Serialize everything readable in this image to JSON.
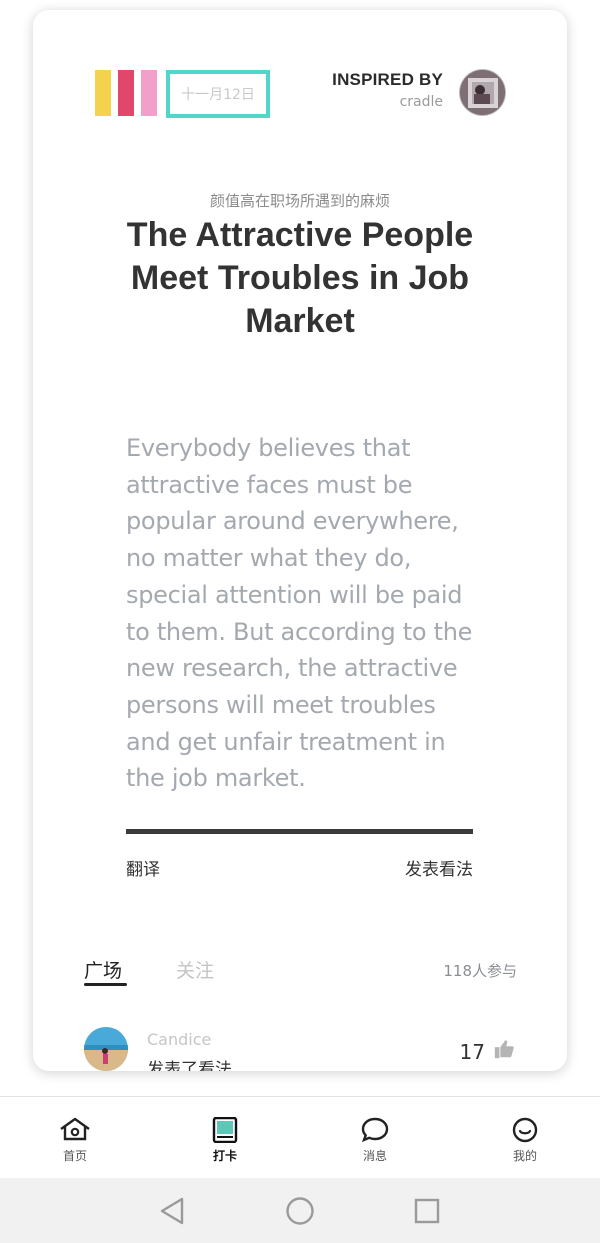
{
  "card": {
    "date": "十一月12日",
    "inspired_by_title": "INSPIRED BY",
    "inspired_by_name": "cradle",
    "subtitle_cn": "颜值高在职场所遇到的麻烦",
    "headline": "The Attractive People Meet Troubles in Job Market",
    "body": "Everybody believes that attractive faces must be popular around everywhere, no matter what they do, special attention will be paid to them. But according to the new research, the attractive persons will meet troubles and get unfair treatment in the job market.",
    "translate_label": "翻译",
    "comment_label": "发表看法"
  },
  "colors": {
    "bar1": "#f5d24b",
    "bar2": "#e1466b",
    "bar3": "#f29fc9",
    "date_border": "#52d6c9"
  },
  "feed": {
    "tabs": [
      "广场",
      "关注"
    ],
    "active_tab": "广场",
    "participants": "118人参与",
    "post": {
      "user": "Candice",
      "action": "发表了看法",
      "likes": "17",
      "like_icon": "thumbs-up-icon"
    }
  },
  "nav": {
    "items": [
      {
        "label": "首页",
        "icon": "home-icon"
      },
      {
        "label": "打卡",
        "icon": "checkin-book-icon"
      },
      {
        "label": "消息",
        "icon": "message-bubble-icon"
      },
      {
        "label": "我的",
        "icon": "profile-smile-icon"
      }
    ],
    "active": "打卡"
  },
  "system_bar": {
    "buttons": [
      "back-icon",
      "home-circle-icon",
      "recents-square-icon"
    ]
  }
}
